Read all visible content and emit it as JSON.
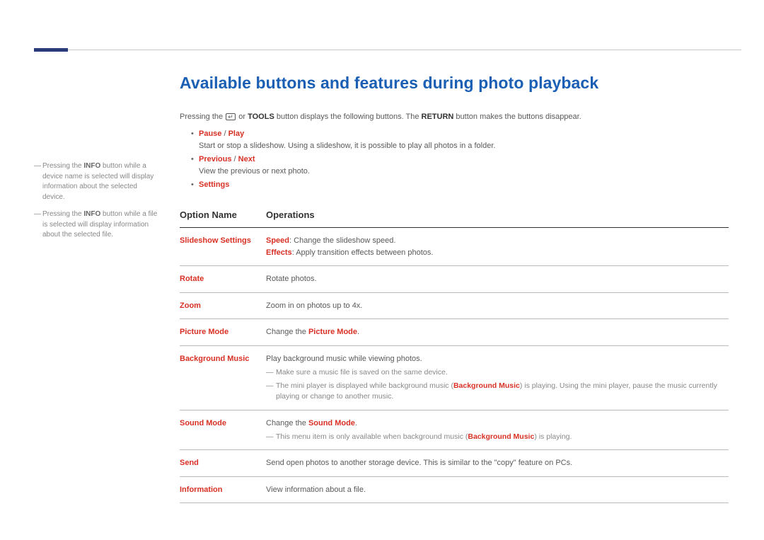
{
  "title": "Available buttons and features during photo playback",
  "intro": {
    "pre": "Pressing the ",
    "tools": "TOOLS",
    "mid": " button displays the following buttons. The ",
    "return": "RETURN",
    "post": " button makes the buttons disappear."
  },
  "sidenotes": {
    "n1_pre": "Pressing the ",
    "n1_bold": "INFO",
    "n1_post": " button while a device name is selected will display information about the selected device.",
    "n2_pre": "Pressing the ",
    "n2_bold": "INFO",
    "n2_post": " button while a file is selected will display information about the selected file."
  },
  "bullets": {
    "pause": "Pause",
    "play": "Play",
    "pause_desc": "Start or stop a slideshow. Using a slideshow, it is possible to play all photos in a folder.",
    "previous": "Previous",
    "next": "Next",
    "prev_desc": "View the previous or next photo.",
    "settings": "Settings"
  },
  "table": {
    "head_option": "Option Name",
    "head_ops": "Operations",
    "slideshow": {
      "name": "Slideshow Settings",
      "speed_label": "Speed",
      "speed_text": ": Change the slideshow speed.",
      "effects_label": "Effects",
      "effects_text": ": Apply transition effects between photos."
    },
    "rotate": {
      "name": "Rotate",
      "text": "Rotate photos."
    },
    "zoom": {
      "name": "Zoom",
      "text": "Zoom in on photos up to 4x."
    },
    "picture": {
      "name": "Picture Mode",
      "pre": "Change the ",
      "bold": "Picture Mode",
      "post": "."
    },
    "bgm": {
      "name": "Background Music",
      "text": "Play background music while viewing photos.",
      "note1": "Make sure a music file is saved on the same device.",
      "note2_pre": "The mini player is displayed while background music (",
      "note2_bold": "Background Music",
      "note2_post": ") is playing. Using the mini player, pause the music currently playing or change to another music."
    },
    "sound": {
      "name": "Sound Mode",
      "pre": "Change the ",
      "bold": "Sound Mode",
      "post": ".",
      "note_pre": "This menu item is only available when background music (",
      "note_bold": "Background Music",
      "note_post": ") is playing."
    },
    "send": {
      "name": "Send",
      "text": "Send open photos to another storage device. This is similar to the \"copy\" feature on PCs."
    },
    "info": {
      "name": "Information",
      "text": "View information about a file."
    }
  }
}
